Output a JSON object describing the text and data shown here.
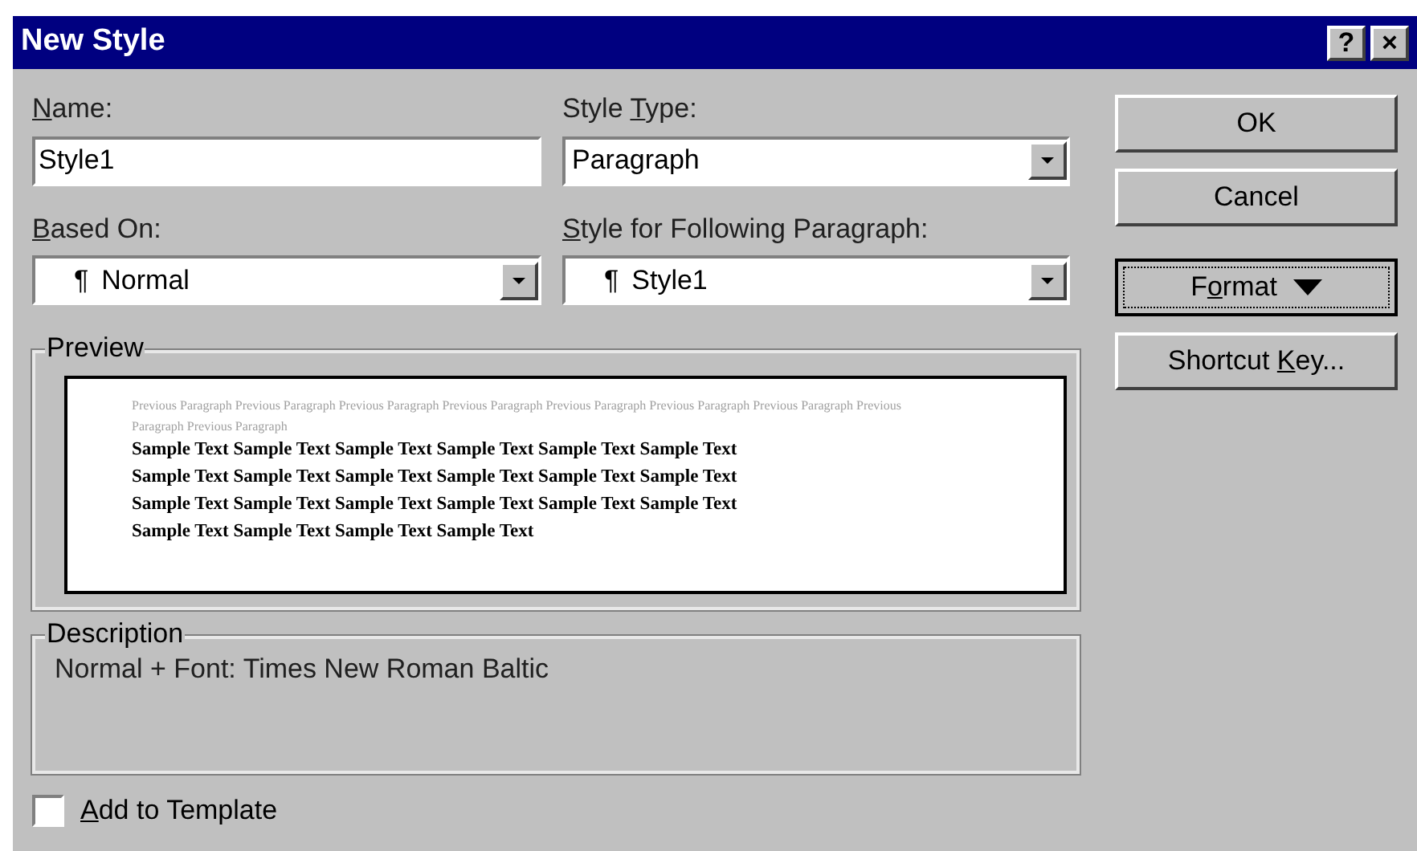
{
  "window": {
    "title": "New Style",
    "controls": [
      "?",
      "×"
    ]
  },
  "name_field": {
    "label": {
      "key": "N",
      "post": "ame:"
    },
    "value": "Style1"
  },
  "style_type": {
    "label": {
      "pre": "Style ",
      "key": "T",
      "post": "ype:"
    },
    "value": "Paragraph"
  },
  "based_on": {
    "label": {
      "key": "B",
      "post": "ased On:"
    },
    "mark": "¶",
    "value": "Normal"
  },
  "following": {
    "label": {
      "key": "S",
      "post": "tyle for Following Paragraph:"
    },
    "mark": "¶",
    "value": "Style1"
  },
  "preview": {
    "title": "Preview",
    "previous_paragraph": "Previous Paragraph Previous Paragraph Previous Paragraph Previous Paragraph Previous Paragraph Previous Paragraph Previous Paragraph Previous Paragraph Previous Paragraph",
    "sample": "Sample Text Sample Text Sample Text Sample Text Sample Text Sample Text Sample Text Sample Text Sample Text Sample Text Sample Text Sample Text Sample Text Sample Text Sample Text Sample Text Sample Text Sample Text Sample Text Sample Text Sample Text Sample Text"
  },
  "description": {
    "title": "Description",
    "text": "Normal + Font: Times New Roman Baltic"
  },
  "add_to_template": {
    "label": {
      "key": "A",
      "post": "dd to Template"
    },
    "checked": false
  },
  "buttons": [
    {
      "kind": "plain",
      "label": {
        "pre": "OK"
      },
      "focused": false
    },
    {
      "kind": "plain",
      "label": {
        "pre": "Cancel"
      },
      "focused": false
    },
    {
      "kind": "menu",
      "label": {
        "pre": "F",
        "key": "o",
        "post": "rmat"
      },
      "focused": true
    },
    {
      "kind": "plain",
      "label": {
        "pre": "Shortcut ",
        "key": "K",
        "post": "ey..."
      },
      "focused": false
    }
  ]
}
